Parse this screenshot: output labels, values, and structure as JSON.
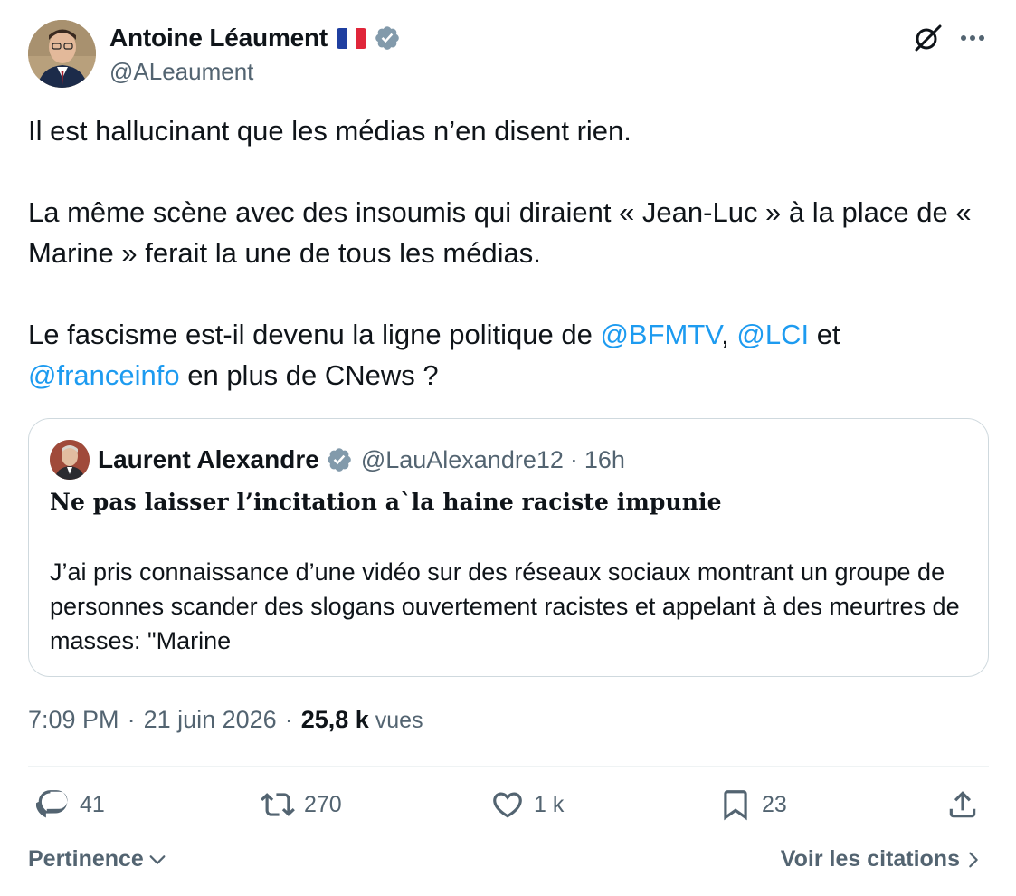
{
  "author": {
    "display_name": "Antoine Léaument",
    "handle": "@ALeaument",
    "flag_icon": "france-flag-icon",
    "verified_icon": "verified-badge-icon"
  },
  "header_actions": {
    "grok_icon": "grok-icon",
    "more_icon": "more-options-icon"
  },
  "tweet": {
    "line1": "Il est hallucinant que les médias n’en disent rien.",
    "line2": "La même scène avec des insoumis qui diraient « Jean-Luc » à la place de « Marine » ferait la une de tous les médias.",
    "line3_pre": "Le fascisme est-il devenu la ligne politique de ",
    "mention1": "@BFMTV",
    "comma": ", ",
    "mention2": "@LCI",
    "line3_mid": " et",
    "mention3": "@franceinfo",
    "line3_end": " en plus de CNews ?"
  },
  "quote": {
    "display_name": "Laurent Alexandre",
    "handle": "@LauAlexandre12",
    "separator": "·",
    "time": "16h",
    "title": "Ne pas laisser l’incitation a`la haine raciste impunie",
    "body": "J’ai pris connaissance d’une vidéo sur des réseaux sociaux montrant un groupe de personnes scander des slogans ouvertement racistes et appelant à des meurtres de masses: \"Marine"
  },
  "meta": {
    "time": "7:09 PM",
    "separator": "·",
    "date": "21 juin 2026",
    "views_count": "25,8 k",
    "views_label": "vues"
  },
  "actions": {
    "replies": "41",
    "reposts": "270",
    "likes": "1 k",
    "bookmarks": "23"
  },
  "footer": {
    "sort_label": "Pertinence",
    "quotes_label": "Voir les citations"
  },
  "colors": {
    "accent": "#1d9bf0",
    "secondary_text": "#536471",
    "verified": "#829aab",
    "border": "#cfd9de"
  }
}
